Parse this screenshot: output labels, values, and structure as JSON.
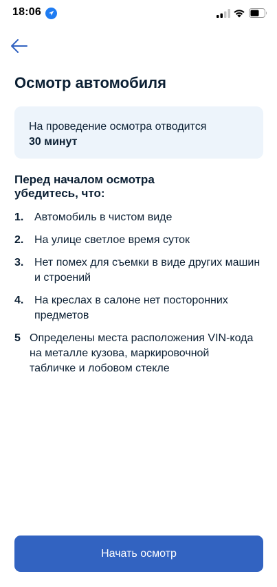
{
  "status_bar": {
    "time": "18:06",
    "icons": [
      "location-arrow-icon",
      "signal-icon",
      "wifi-icon",
      "battery-icon"
    ]
  },
  "nav": {
    "back_icon": "arrow-left-icon"
  },
  "title": "Осмотр автомобиля",
  "info": {
    "text": "На проведение осмотра отводится",
    "duration": "30 минут"
  },
  "checklist": {
    "heading": "Перед началом осмотра убедитесь, что:",
    "items": [
      {
        "number": "1.",
        "text": "Автомобиль в чистом виде"
      },
      {
        "number": "2.",
        "text": "На улице светлое время суток"
      },
      {
        "number": "3.",
        "text": "Нет помех для съемки в виде других машин и строений"
      },
      {
        "number": "4.",
        "text": "На креслах в салоне нет посторонних предметов"
      },
      {
        "number": "5",
        "text": "Определены места расположения VIN-кода на металле кузова, маркировочной табличке и лобовом стекле"
      }
    ]
  },
  "actions": {
    "start_label": "Начать осмотр"
  },
  "colors": {
    "accent": "#3263c1",
    "card_background": "#edf4fb",
    "text": "#0b1f33"
  }
}
